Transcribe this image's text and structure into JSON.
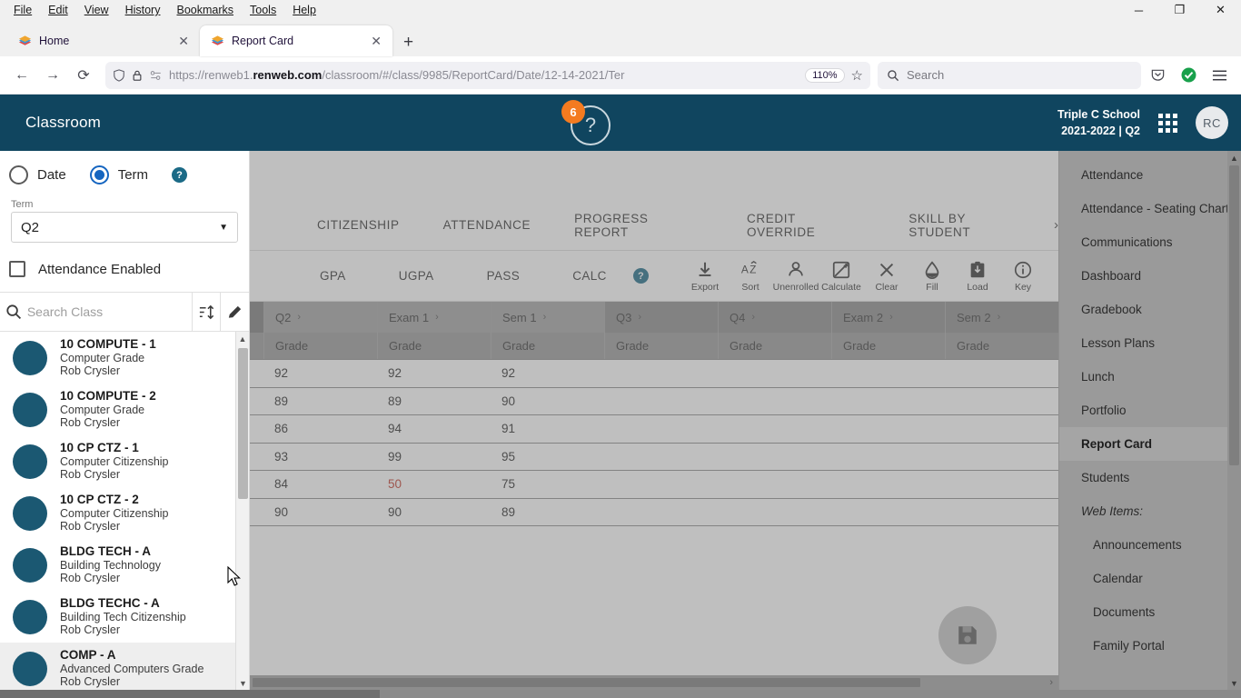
{
  "browser": {
    "menus": [
      "File",
      "Edit",
      "View",
      "History",
      "Bookmarks",
      "Tools",
      "Help"
    ],
    "window_controls": {
      "minimize": "─",
      "maximize": "❐",
      "close": "✕"
    },
    "tabs": [
      {
        "title": "Home",
        "close": "✕",
        "active": false
      },
      {
        "title": "Report Card",
        "close": "✕",
        "active": true
      }
    ],
    "new_tab": "+",
    "nav": {
      "back": "←",
      "forward": "→",
      "reload": "⟳"
    },
    "url_prefix": "https://renweb1.",
    "url_domain": "renweb.com",
    "url_path": "/classroom/#/class/9985/ReportCard/Date/12-14-2021/Ter",
    "zoom_level": "110%",
    "star": "☆",
    "search_placeholder": "Search",
    "icons": {
      "shield": "shield-icon",
      "lock": "lock-icon",
      "permissions": "permissions-icon",
      "pocket": "pocket-icon",
      "extension_check": "green-check-icon",
      "menu": "hamburger-menu-icon"
    }
  },
  "app_header": {
    "brand": "Classroom",
    "help_badge_count": "6",
    "help_glyph": "?",
    "school_name": "Triple C School",
    "school_term": "2021-2022 | Q2",
    "avatar_initials": "RC"
  },
  "left_panel": {
    "mode_date_label": "Date",
    "mode_term_label": "Term",
    "mode_selected": "Term",
    "help_glyph": "?",
    "term_field_label": "Term",
    "term_value": "Q2",
    "attendance_checkbox_label": "Attendance Enabled",
    "attendance_checked": false,
    "search_placeholder": "Search Class",
    "sort_icon": "sort-icon",
    "edit_icon": "pencil-icon",
    "classes": [
      {
        "code": "10 COMPUTE - 1",
        "subject": "Computer Grade",
        "teacher": "Rob Crysler"
      },
      {
        "code": "10 COMPUTE - 2",
        "subject": "Computer Grade",
        "teacher": "Rob Crysler"
      },
      {
        "code": "10 CP CTZ - 1",
        "subject": "Computer Citizenship",
        "teacher": "Rob Crysler"
      },
      {
        "code": "10 CP CTZ - 2",
        "subject": "Computer Citizenship",
        "teacher": "Rob Crysler"
      },
      {
        "code": "BLDG TECH - A",
        "subject": "Building Technology",
        "teacher": "Rob Crysler"
      },
      {
        "code": "BLDG TECHC - A",
        "subject": "Building Tech Citizenship",
        "teacher": "Rob Crysler"
      },
      {
        "code": "COMP - A",
        "subject": "Advanced Computers Grade",
        "teacher": "Rob Crysler"
      }
    ]
  },
  "main": {
    "tabs": [
      "CITIZENSHIP",
      "ATTENDANCE",
      "PROGRESS REPORT",
      "CREDIT OVERRIDE",
      "SKILL BY STUDENT"
    ],
    "tabs_next_arrow": "›",
    "calc_buttons": [
      "GPA",
      "UGPA",
      "PASS",
      "CALC"
    ],
    "calc_help_glyph": "?",
    "tools": [
      {
        "label": "Export",
        "icon": "download-icon"
      },
      {
        "label": "Sort",
        "icon": "sort-az-icon"
      },
      {
        "label": "Unenrolled",
        "icon": "person-icon"
      },
      {
        "label": "Calculate",
        "icon": "calculate-icon"
      },
      {
        "label": "Clear",
        "icon": "close-x-icon"
      },
      {
        "label": "Fill",
        "icon": "fill-drop-icon"
      },
      {
        "label": "Load",
        "icon": "load-icon"
      },
      {
        "label": "Key",
        "icon": "info-icon"
      }
    ],
    "grid": {
      "columns": [
        {
          "label": "Q2",
          "chevron": "›",
          "active": true
        },
        {
          "label": "Exam 1",
          "chevron": "›",
          "active": true
        },
        {
          "label": "Sem 1",
          "chevron": "›",
          "active": true
        },
        {
          "label": "Q3",
          "chevron": "›",
          "active": false
        },
        {
          "label": "Q4",
          "chevron": "›",
          "active": false
        },
        {
          "label": "Exam 2",
          "chevron": "›",
          "active": false
        },
        {
          "label": "Sem 2",
          "chevron": "›",
          "active": false
        }
      ],
      "subheaders": [
        "Grade",
        "Grade",
        "Grade",
        "Grade",
        "Grade",
        "Grade",
        "Grade"
      ],
      "rows": [
        [
          {
            "v": "92"
          },
          {
            "v": "92"
          },
          {
            "v": "92"
          },
          {
            "v": ""
          },
          {
            "v": ""
          },
          {
            "v": ""
          },
          {
            "v": ""
          }
        ],
        [
          {
            "v": "89"
          },
          {
            "v": "89"
          },
          {
            "v": "90"
          },
          {
            "v": ""
          },
          {
            "v": ""
          },
          {
            "v": ""
          },
          {
            "v": ""
          }
        ],
        [
          {
            "v": "86"
          },
          {
            "v": "94"
          },
          {
            "v": "91"
          },
          {
            "v": ""
          },
          {
            "v": ""
          },
          {
            "v": ""
          },
          {
            "v": ""
          }
        ],
        [
          {
            "v": "93"
          },
          {
            "v": "99"
          },
          {
            "v": "95"
          },
          {
            "v": ""
          },
          {
            "v": ""
          },
          {
            "v": ""
          },
          {
            "v": ""
          }
        ],
        [
          {
            "v": "84"
          },
          {
            "v": "50",
            "fail": true
          },
          {
            "v": "75"
          },
          {
            "v": ""
          },
          {
            "v": ""
          },
          {
            "v": ""
          },
          {
            "v": ""
          }
        ],
        [
          {
            "v": "90"
          },
          {
            "v": "90"
          },
          {
            "v": "89"
          },
          {
            "v": ""
          },
          {
            "v": ""
          },
          {
            "v": ""
          },
          {
            "v": ""
          }
        ]
      ]
    },
    "save_fab_icon": "save-floppy-icon",
    "hscroll_arrow": "›"
  },
  "right_panel": {
    "items": [
      {
        "label": "Attendance",
        "style": "normal"
      },
      {
        "label": "Attendance - Seating Chart",
        "style": "normal"
      },
      {
        "label": "Communications",
        "style": "normal"
      },
      {
        "label": "Dashboard",
        "style": "normal"
      },
      {
        "label": "Gradebook",
        "style": "normal"
      },
      {
        "label": "Lesson Plans",
        "style": "normal"
      },
      {
        "label": "Lunch",
        "style": "normal"
      },
      {
        "label": "Portfolio",
        "style": "normal"
      },
      {
        "label": "Report Card",
        "style": "active"
      },
      {
        "label": "Students",
        "style": "normal"
      },
      {
        "label": "Web Items:",
        "style": "section"
      },
      {
        "label": "Announcements",
        "style": "sub"
      },
      {
        "label": "Calendar",
        "style": "sub"
      },
      {
        "label": "Documents",
        "style": "sub"
      },
      {
        "label": "Family Portal",
        "style": "sub"
      }
    ],
    "scroll_up": "▲",
    "scroll_down": "▼"
  },
  "colors": {
    "app_header": "#10455f",
    "accent_orange": "#f47b20",
    "radio_blue": "#1565c0",
    "fail_red": "#c0392b",
    "class_dot": "#1b5872"
  }
}
